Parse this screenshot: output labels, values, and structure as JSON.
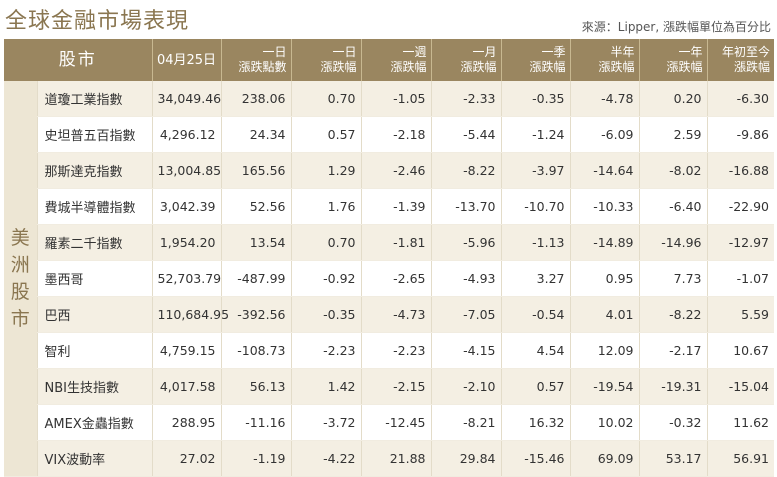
{
  "title": "全球金融市場表現",
  "source_note": "來源：Lipper, 漲跌幅單位為百分比",
  "headers": {
    "market": "股市",
    "date": "04月25日",
    "columns": [
      {
        "l1": "一日",
        "l2": "漲跌點數"
      },
      {
        "l1": "一日",
        "l2": "漲跌幅"
      },
      {
        "l1": "一週",
        "l2": "漲跌幅"
      },
      {
        "l1": "一月",
        "l2": "漲跌幅"
      },
      {
        "l1": "一季",
        "l2": "漲跌幅"
      },
      {
        "l1": "半年",
        "l2": "漲跌幅"
      },
      {
        "l1": "一年",
        "l2": "漲跌幅"
      },
      {
        "l1": "年初至今",
        "l2": "漲跌幅"
      }
    ]
  },
  "region": [
    "美",
    "洲",
    "股",
    "市"
  ],
  "rows": [
    {
      "name": "道瓊工業指數",
      "values": [
        "34,049.46",
        "238.06",
        "0.70",
        "-1.05",
        "-2.33",
        "-0.35",
        "-4.78",
        "0.20",
        "-6.30"
      ]
    },
    {
      "name": "史坦普五百指數",
      "values": [
        "4,296.12",
        "24.34",
        "0.57",
        "-2.18",
        "-5.44",
        "-1.24",
        "-6.09",
        "2.59",
        "-9.86"
      ]
    },
    {
      "name": "那斯達克指數",
      "values": [
        "13,004.85",
        "165.56",
        "1.29",
        "-2.46",
        "-8.22",
        "-3.97",
        "-14.64",
        "-8.02",
        "-16.88"
      ]
    },
    {
      "name": "費城半導體指數",
      "values": [
        "3,042.39",
        "52.56",
        "1.76",
        "-1.39",
        "-13.70",
        "-10.70",
        "-10.33",
        "-6.40",
        "-22.90"
      ]
    },
    {
      "name": "羅素二千指數",
      "values": [
        "1,954.20",
        "13.54",
        "0.70",
        "-1.81",
        "-5.96",
        "-1.13",
        "-14.89",
        "-14.96",
        "-12.97"
      ]
    },
    {
      "name": "墨西哥",
      "values": [
        "52,703.79",
        "-487.99",
        "-0.92",
        "-2.65",
        "-4.93",
        "3.27",
        "0.95",
        "7.73",
        "-1.07"
      ]
    },
    {
      "name": "巴西",
      "values": [
        "110,684.95",
        "-392.56",
        "-0.35",
        "-4.73",
        "-7.05",
        "-0.54",
        "4.01",
        "-8.22",
        "5.59"
      ]
    },
    {
      "name": "智利",
      "values": [
        "4,759.15",
        "-108.73",
        "-2.23",
        "-2.23",
        "-4.15",
        "4.54",
        "12.09",
        "-2.17",
        "10.67"
      ]
    },
    {
      "name": "NBI生技指數",
      "values": [
        "4,017.58",
        "56.13",
        "1.42",
        "-2.15",
        "-2.10",
        "0.57",
        "-19.54",
        "-19.31",
        "-15.04"
      ]
    },
    {
      "name": "AMEX金蟲指數",
      "values": [
        "288.95",
        "-11.16",
        "-3.72",
        "-12.45",
        "-8.21",
        "16.32",
        "10.02",
        "-0.32",
        "11.62"
      ]
    },
    {
      "name": "VIX波動率",
      "values": [
        "27.02",
        "-1.19",
        "-4.22",
        "21.88",
        "29.84",
        "-15.46",
        "69.09",
        "53.17",
        "56.91"
      ]
    }
  ]
}
